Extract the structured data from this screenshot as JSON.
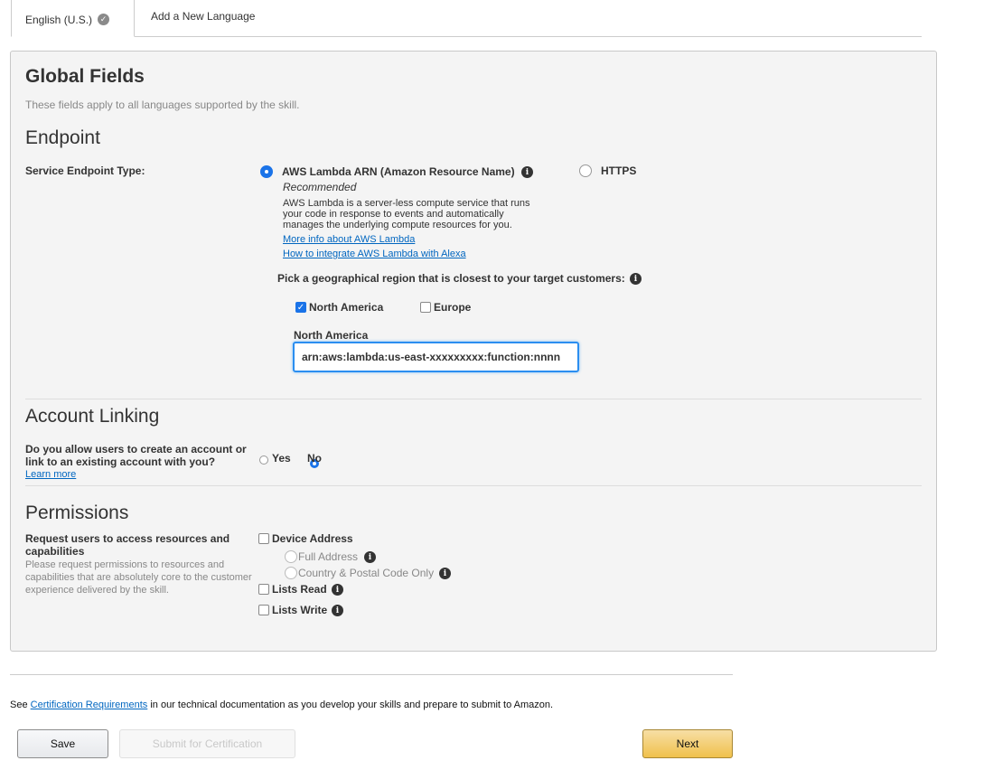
{
  "tabs": {
    "active_label": "English (U.S.)",
    "new_label": "Add a New Language"
  },
  "global": {
    "title": "Global Fields",
    "subtitle": "These fields apply to all languages supported by the skill."
  },
  "endpoint": {
    "title": "Endpoint",
    "type_label": "Service Endpoint Type:",
    "lambda_option": "AWS Lambda ARN (Amazon Resource Name)",
    "recommended": "Recommended",
    "lambda_desc_1": "AWS Lambda is a server-less compute service that runs",
    "lambda_desc_2": "your code in response to events and automatically",
    "lambda_desc_3": "manages the underlying compute resources for you.",
    "link_more_info": "More info about AWS Lambda",
    "link_integrate": "How to integrate AWS Lambda with Alexa",
    "https_option": "HTTPS",
    "region_prompt": "Pick a geographical region that is closest to your target customers:",
    "region_na": "North America",
    "region_eu": "Europe",
    "na_field_label": "North America",
    "na_arn_value": "arn:aws:lambda:us-east-xxxxxxxxx:function:nnnn"
  },
  "account_linking": {
    "title": "Account Linking",
    "question_1": "Do you allow users to create an account or",
    "question_2": "link to an existing account with you?",
    "learn_more": "Learn more",
    "yes": "Yes",
    "no": "No",
    "selected": "No"
  },
  "permissions": {
    "title": "Permissions",
    "label_1": "Request users to access resources and",
    "label_2": "capabilities",
    "help_1": "Please request permissions to resources and",
    "help_2": "capabilities that are absolutely core to the customer",
    "help_3": "experience delivered by the skill.",
    "device_address": "Device Address",
    "full_address": "Full Address",
    "country_postal": "Country & Postal Code Only",
    "lists_read": "Lists Read",
    "lists_write": "Lists Write"
  },
  "footer": {
    "see": "See",
    "cert_link": "Certification Requirements",
    "rest": "in our technical documentation as you develop your skills and prepare to submit to Amazon.",
    "save": "Save",
    "submit": "Submit for Certification",
    "next": "Next"
  },
  "colors": {
    "accent": "#1a73e8",
    "link": "#0066c0",
    "next_button": "#f0c14b"
  }
}
